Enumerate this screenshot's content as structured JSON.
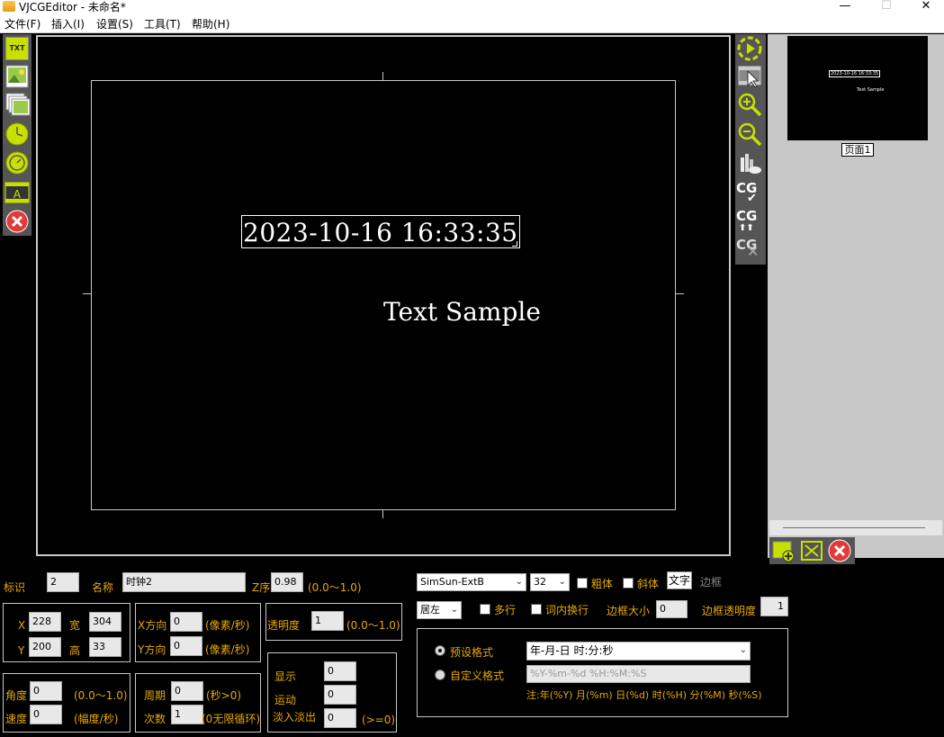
{
  "window": {
    "title": "VJCGEditor - 未命名*",
    "min": "—",
    "max": "☐",
    "close": "✕"
  },
  "menu": [
    "文件(F)",
    "插入(I)",
    "设置(S)",
    "工具(T)",
    "帮助(H)"
  ],
  "canvas": {
    "clock_text": "2023-10-16 16:33:35",
    "sample_text": "Text Sample"
  },
  "left_tools": {
    "txt": "TXT",
    "text_frame": "A"
  },
  "right_tools": {
    "cg": "CG"
  },
  "thumbnail": {
    "page_label": "页面1",
    "mini_clock": "2023-10-16 16:33:35",
    "mini_sample": "Text Sample"
  },
  "props": {
    "id_label": "标识",
    "id_value": "2",
    "name_label": "名称",
    "name_value": "时钟2",
    "z_label": "Z序",
    "z_value": "0.98",
    "z_range": "(0.0～1.0)",
    "x_label": "X",
    "x_value": "228",
    "w_label": "宽",
    "w_value": "304",
    "y_label": "Y",
    "y_value": "200",
    "h_label": "高",
    "h_value": "33",
    "xdir_label": "X方向",
    "xdir_value": "0",
    "xdir_unit": "(像素/秒)",
    "ydir_label": "Y方向",
    "ydir_value": "0",
    "ydir_unit": "(像素/秒)",
    "opacity_label": "透明度",
    "opacity_value": "1",
    "opacity_range": "(0.0～1.0)",
    "angle_label": "角度",
    "angle_value": "0",
    "angle_range": "(0.0～1.0)",
    "speed_label": "速度",
    "speed_value": "0",
    "speed_unit": "(幅度/秒)",
    "period_label": "周期",
    "period_value": "0",
    "period_unit": "(秒>0)",
    "count_label": "次数",
    "count_value": "1",
    "count_unit": "(0无限循环)",
    "show_label": "显示",
    "show_value": "0",
    "move_label": "运动",
    "move_value": "0",
    "fade_label": "淡入淡出",
    "fade_value": "0",
    "fade_unit": "(>=0)"
  },
  "text_style": {
    "font": "SimSun-ExtB",
    "size": "32",
    "bold_label": "粗体",
    "italic_label": "斜体",
    "text_btn": "文字",
    "border_label": "边框",
    "align": "居左",
    "multiline_label": "多行",
    "wrap_label": "词内换行",
    "border_size_label": "边框大小",
    "border_size_value": "0",
    "border_opacity_label": "边框透明度",
    "border_opacity_value": "1"
  },
  "format": {
    "preset_label": "预设格式",
    "preset_value": "年-月-日 时:分:秒",
    "custom_label": "自定义格式",
    "custom_value": "%Y-%m-%d %H:%M:%S",
    "note": "注:年(%Y) 月(%m) 日(%d) 时(%H) 分(%M) 秒(%S)"
  },
  "colors": {
    "accent": "#e8a800",
    "panel": "#555555",
    "icon_green": "#c8e000"
  }
}
